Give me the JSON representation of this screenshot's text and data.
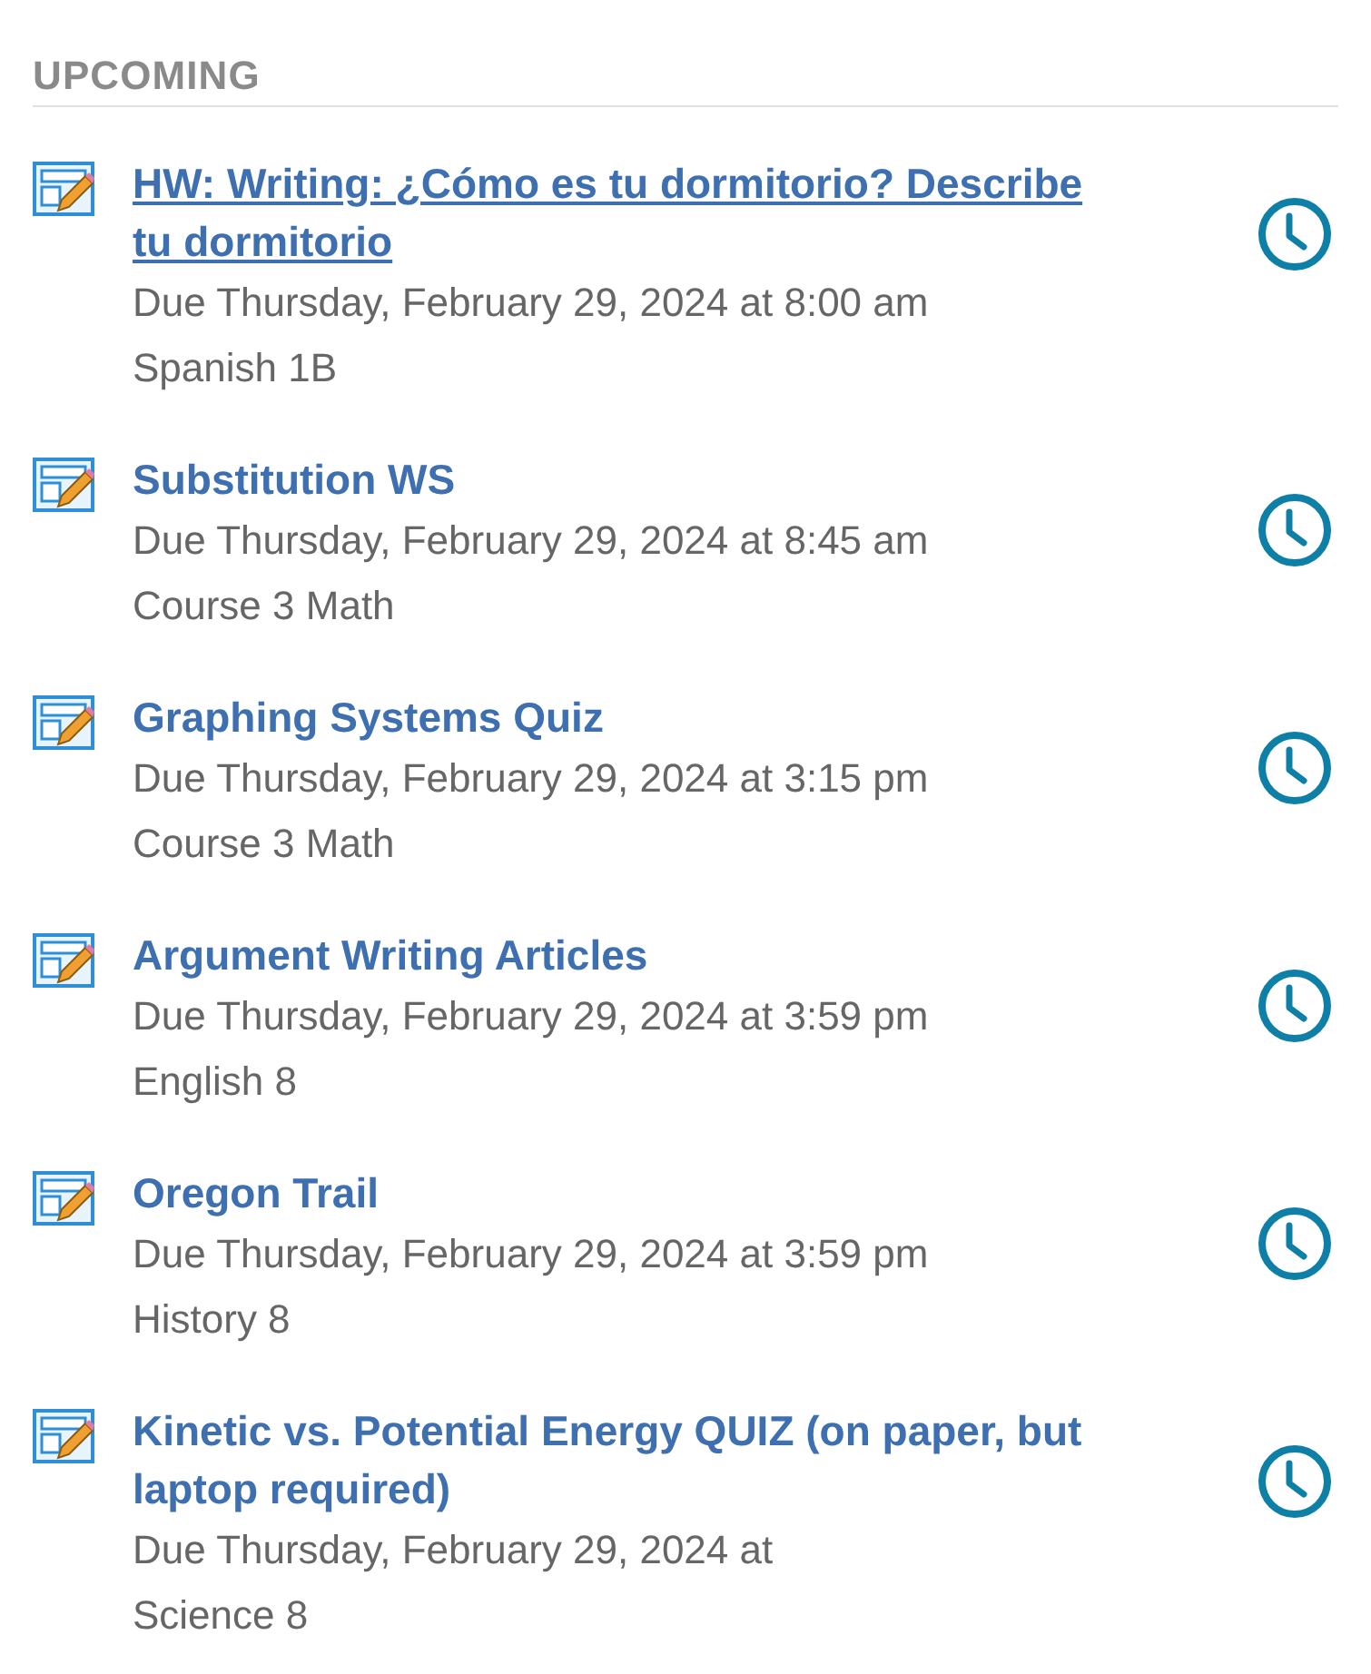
{
  "section": {
    "title": "UPCOMING"
  },
  "items": [
    {
      "title": "HW: Writing: ¿Cómo es tu dormitorio? Describe tu dormitorio",
      "hovered": true,
      "due": "Due Thursday, February 29, 2024 at 8:00 am",
      "course": "Spanish 1B"
    },
    {
      "title": "Substitution WS",
      "hovered": false,
      "due": "Due Thursday, February 29, 2024 at 8:45 am",
      "course": "Course 3 Math"
    },
    {
      "title": "Graphing Systems Quiz",
      "hovered": false,
      "due": "Due Thursday, February 29, 2024 at 3:15 pm",
      "course": "Course 3 Math"
    },
    {
      "title": "Argument Writing Articles",
      "hovered": false,
      "due": "Due Thursday, February 29, 2024 at 3:59 pm",
      "course": "English 8"
    },
    {
      "title": "Oregon Trail",
      "hovered": false,
      "due": "Due Thursday, February 29, 2024 at 3:59 pm",
      "course": "History 8"
    },
    {
      "title": "Kinetic vs. Potential Energy QUIZ (on paper, but laptop required)",
      "hovered": false,
      "due": "Due Thursday, February 29, 2024 at",
      "course": "Science 8"
    }
  ]
}
